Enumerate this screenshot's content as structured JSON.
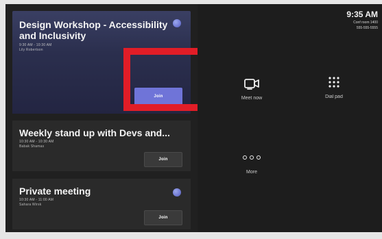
{
  "left_panel": {
    "meetings": [
      {
        "title": "Design Workshop - Accessibility and Inclusivity",
        "time": "9:30 AM - 10:30 AM",
        "organizer": "Lily Robertson",
        "join_label": "Join",
        "has_teams_icon": true
      },
      {
        "title": "Weekly stand up with Devs and...",
        "time": "10:30 AM - 10:30 AM",
        "organizer": "Babak Shamas",
        "join_label": "Join",
        "has_teams_icon": false
      },
      {
        "title": "Private meeting",
        "time": "10:30 AM - 11:00 AM",
        "organizer": "Sahara Wirsk",
        "join_label": "Join",
        "has_teams_icon": true
      }
    ]
  },
  "header": {
    "time": "9:35 AM",
    "room_name": "Conf room 1400",
    "room_phone": "555-555-5555"
  },
  "actions": [
    {
      "label": "Meet now",
      "icon": "video-camera-icon"
    },
    {
      "label": "Dial pad",
      "icon": "dialpad-icon"
    },
    {
      "label": "More",
      "icon": "more-dots-icon"
    }
  ],
  "colors": {
    "screen_bg": "#1d1d1d",
    "featured_join": "#6f74d8",
    "highlight": "#e11d27"
  }
}
